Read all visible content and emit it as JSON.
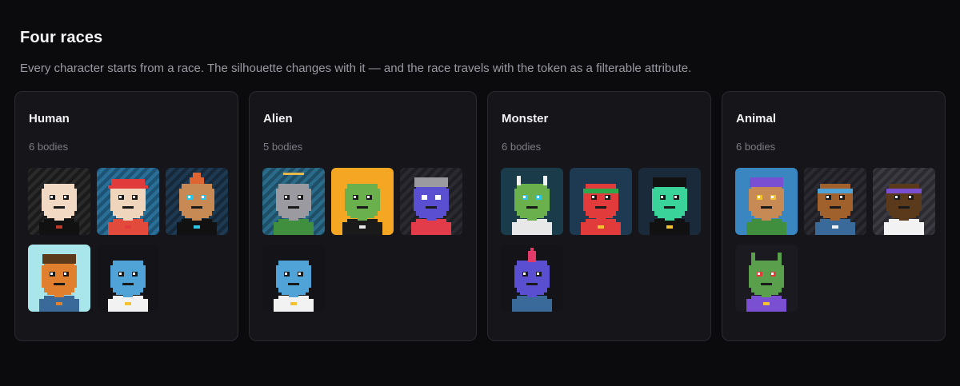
{
  "section": {
    "title": "Four races",
    "subtitle": "Every character starts from a race. The silhouette changes with it — and the race travels with the token as a filterable attribute."
  },
  "races": [
    {
      "name": "Human",
      "count": "6 bodies",
      "avatars": [
        {
          "bg": "#1a1a1a",
          "stripe": "#2a2a2a",
          "head": "#f2d9c4",
          "body": "#111111",
          "hat": "none",
          "eyes": "#1a1a1a",
          "accent": "#c0392b"
        },
        {
          "bg": "#2a6f97",
          "stripe": "#1d5476",
          "head": "#f0d5bd",
          "body": "#e24a3b",
          "hat": "cap",
          "hatColor": "#e23b3b",
          "eyes": "#1a1a1a",
          "accent": "#e23b3b"
        },
        {
          "bg": "#1d3a52",
          "stripe": "#16293a",
          "head": "#c88a55",
          "body": "#111111",
          "hat": "flame",
          "hatColor": "#e0642f",
          "eyes": "#2ec4e6",
          "accent": "#2ec4e6"
        },
        {
          "bg": "#a8e6ec",
          "stripe": "#a8e6ec",
          "head": "#e07f2d",
          "body": "#3a6a9a",
          "hat": "beanie",
          "hatColor": "#5a3a1a",
          "eyes": "#1a1a1a",
          "accent": "#e07f2d"
        },
        {
          "bg": "#141418",
          "stripe": "#141418",
          "head": "#4fa3d6",
          "body": "#f2f2f2",
          "hat": "none",
          "eyes": "#1a1a1a",
          "accent": "#f2c230"
        }
      ]
    },
    {
      "name": "Alien",
      "count": "5 bodies",
      "avatars": [
        {
          "bg": "#2b6b8a",
          "stripe": "#1f4f66",
          "head": "#9a9aa0",
          "body": "#3f8f3f",
          "hat": "halo",
          "hatColor": "#e8b84a",
          "eyes": "#1a1a1a",
          "accent": "#3f8f3f"
        },
        {
          "bg": "#f5a623",
          "stripe": "#f5a623",
          "head": "#6ab04c",
          "body": "#1a1a1a",
          "hat": "none",
          "eyes": "#1a1a1a",
          "accent": "#e8e8e8"
        },
        {
          "bg": "#1e1e24",
          "stripe": "#2a2a30",
          "head": "#5b4fd1",
          "body": "#e23b4a",
          "hat": "beanie",
          "hatColor": "#9a9aa0",
          "eyes": "#ffffff",
          "accent": "#e23b4a"
        },
        {
          "bg": "#141418",
          "stripe": "#141418",
          "head": "#4fa3d6",
          "body": "#f2f2f2",
          "hat": "none",
          "eyes": "#1a1a1a",
          "accent": "#f2c230"
        }
      ]
    },
    {
      "name": "Monster",
      "count": "6 bodies",
      "avatars": [
        {
          "bg": "#1a3b4a",
          "stripe": "#1a3b4a",
          "head": "#6ab04c",
          "body": "#e8e8e8",
          "hat": "horns",
          "hatColor": "#f2f2f2",
          "eyes": "#2ec4e6",
          "accent": "#e8e8e8"
        },
        {
          "bg": "#1d3a52",
          "stripe": "#1d3a52",
          "head": "#e23b3b",
          "body": "#e23b3b",
          "hat": "band",
          "hatColor": "#2ea84a",
          "eyes": "#1a1a1a",
          "accent": "#f2c230"
        },
        {
          "bg": "#1a2a3a",
          "stripe": "#1a2a3a",
          "head": "#3ad39a",
          "body": "#111111",
          "hat": "beanie",
          "hatColor": "#111111",
          "eyes": "#1a1a1a",
          "accent": "#f2c230"
        },
        {
          "bg": "#141418",
          "stripe": "#141418",
          "head": "#5b4fd1",
          "body": "#3a6a9a",
          "hat": "spike",
          "hatColor": "#e23b6a",
          "eyes": "#1a1a1a",
          "accent": "#3a6a9a"
        }
      ]
    },
    {
      "name": "Animal",
      "count": "6 bodies",
      "avatars": [
        {
          "bg": "#3a86c0",
          "stripe": "#3a86c0",
          "head": "#c88a55",
          "body": "#3f8f3f",
          "hat": "beanie",
          "hatColor": "#7a4fd1",
          "eyes": "#f2c230",
          "accent": "#3f8f3f"
        },
        {
          "bg": "#1e1e24",
          "stripe": "#2a2a30",
          "head": "#a0612d",
          "body": "#3a6a9a",
          "hat": "band",
          "hatColor": "#4fa3d6",
          "eyes": "#1a1a1a",
          "accent": "#f2f2f2"
        },
        {
          "bg": "#2a2a30",
          "stripe": "#3a3a40",
          "head": "#5a3a1a",
          "body": "#f2f2f2",
          "hat": "band",
          "hatColor": "#7a4fd1",
          "eyes": "#1a1a1a",
          "accent": "#f2f2f2"
        },
        {
          "bg": "#1a1a20",
          "stripe": "#1a1a20",
          "head": "#5aa04c",
          "body": "#7a4fd1",
          "hat": "horns",
          "hatColor": "#5aa04c",
          "eyes": "#e23b3b",
          "accent": "#f2c230"
        }
      ]
    }
  ]
}
